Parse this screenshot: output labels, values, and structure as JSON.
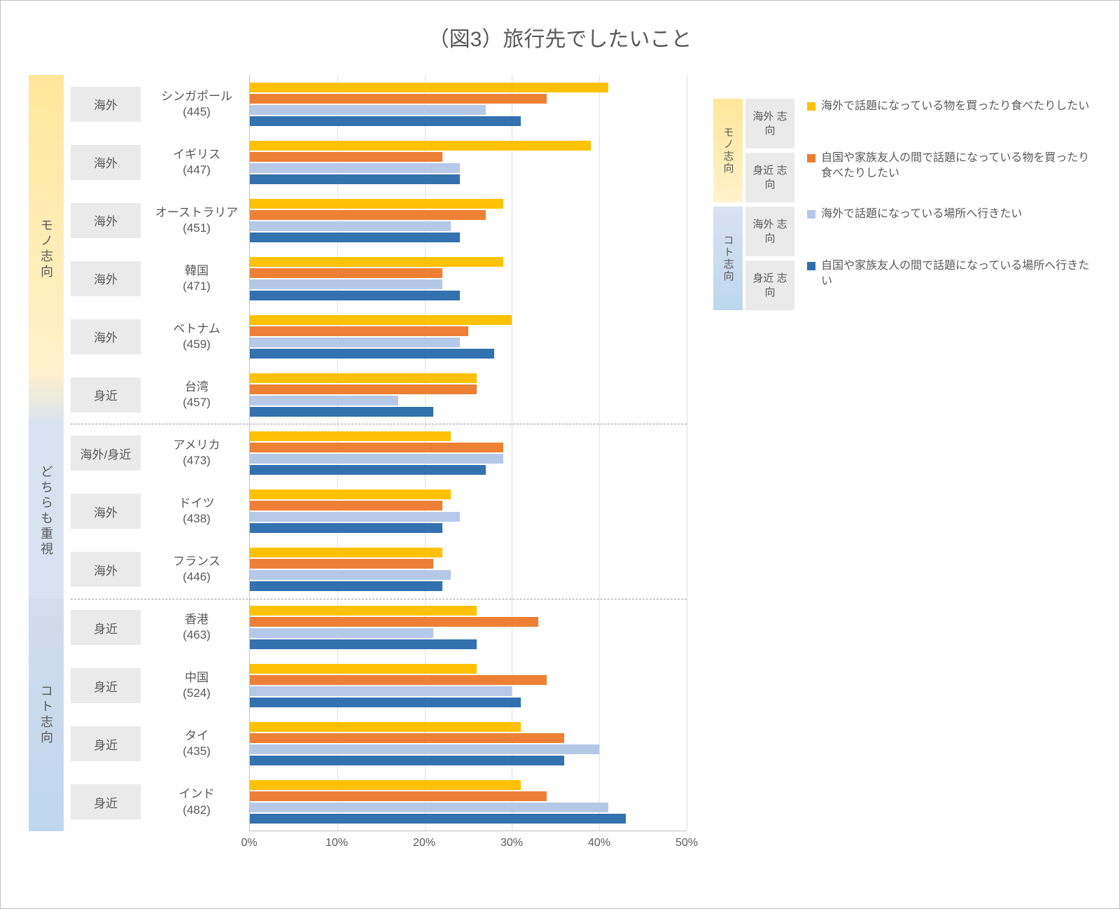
{
  "title": "（図3）旅行先でしたいこと",
  "x_ticks": [
    "0%",
    "10%",
    "20%",
    "30%",
    "40%",
    "50%"
  ],
  "x_max_percent": 50,
  "series_colors": {
    "s1": "#ffc000",
    "s2": "#ed7d31",
    "s3": "#b4c7e7",
    "s4": "#2f6ead"
  },
  "groups": [
    {
      "key": "g1",
      "label": "モノ志向",
      "start_row": 0,
      "end_row": 6,
      "class": "grad-yellow"
    },
    {
      "key": "g2",
      "label": "どちらも重視",
      "start_row": 6,
      "end_row": 9,
      "class": "grad-mid"
    },
    {
      "key": "g3",
      "label": "コト志向",
      "start_row": 9,
      "end_row": 13,
      "class": "grad-blue"
    }
  ],
  "legend": {
    "mono_label": "モノ志向",
    "koto_label": "コト志向",
    "tile_overseas": "海外\n志向",
    "tile_familiar": "身近\n志向",
    "items": [
      {
        "key": "s1",
        "color_class": "c-yellow",
        "text": "海外で話題になっている物を買ったり食べたりしたい"
      },
      {
        "key": "s2",
        "color_class": "c-orange",
        "text": "自国や家族友人の間で話題になっている物を買ったり食べたりしたい"
      },
      {
        "key": "s3",
        "color_class": "c-lightblue",
        "text": "海外で話題になっている場所へ行きたい"
      },
      {
        "key": "s4",
        "color_class": "c-blue",
        "text": "自国や家族友人の間で話題になっている場所へ行きたい"
      }
    ]
  },
  "chart_data": {
    "type": "bar",
    "orientation": "horizontal",
    "xlabel": "",
    "ylabel": "",
    "title": "（図3）旅行先でしたいこと",
    "xlim": [
      0,
      50
    ],
    "series": [
      {
        "key": "s1",
        "name": "海外で話題になっている物を買ったり食べたりしたい",
        "values": [
          41,
          39,
          29,
          29,
          30,
          26,
          23,
          23,
          22,
          26,
          26,
          31,
          31
        ]
      },
      {
        "key": "s2",
        "name": "自国や家族友人の間で話題になっている物を買ったり食べたりしたい",
        "values": [
          34,
          22,
          27,
          22,
          25,
          26,
          29,
          22,
          21,
          33,
          34,
          36,
          34
        ]
      },
      {
        "key": "s3",
        "name": "海外で話題になっている場所へ行きたい",
        "values": [
          27,
          24,
          23,
          22,
          24,
          17,
          29,
          24,
          23,
          21,
          30,
          40,
          41
        ]
      },
      {
        "key": "s4",
        "name": "自国や家族友人の間で話題になっている場所へ行きたい",
        "values": [
          31,
          24,
          24,
          24,
          28,
          21,
          27,
          22,
          22,
          26,
          31,
          36,
          43
        ]
      }
    ],
    "categories": [
      {
        "name": "シンガポール",
        "n": 445,
        "tag": "海外",
        "group": "g1"
      },
      {
        "name": "イギリス",
        "n": 447,
        "tag": "海外",
        "group": "g1"
      },
      {
        "name": "オーストラリア",
        "n": 451,
        "tag": "海外",
        "group": "g1"
      },
      {
        "name": "韓国",
        "n": 471,
        "tag": "海外",
        "group": "g1"
      },
      {
        "name": "ベトナム",
        "n": 459,
        "tag": "海外",
        "group": "g1"
      },
      {
        "name": "台湾",
        "n": 457,
        "tag": "身近",
        "group": "g1"
      },
      {
        "name": "アメリカ",
        "n": 473,
        "tag": "海外/身近",
        "group": "g2"
      },
      {
        "name": "ドイツ",
        "n": 438,
        "tag": "海外",
        "group": "g2"
      },
      {
        "name": "フランス",
        "n": 446,
        "tag": "海外",
        "group": "g2"
      },
      {
        "name": "香港",
        "n": 463,
        "tag": "身近",
        "group": "g3"
      },
      {
        "name": "中国",
        "n": 524,
        "tag": "身近",
        "group": "g3"
      },
      {
        "name": "タイ",
        "n": 435,
        "tag": "身近",
        "group": "g3"
      },
      {
        "name": "インド",
        "n": 482,
        "tag": "身近",
        "group": "g3"
      }
    ]
  }
}
